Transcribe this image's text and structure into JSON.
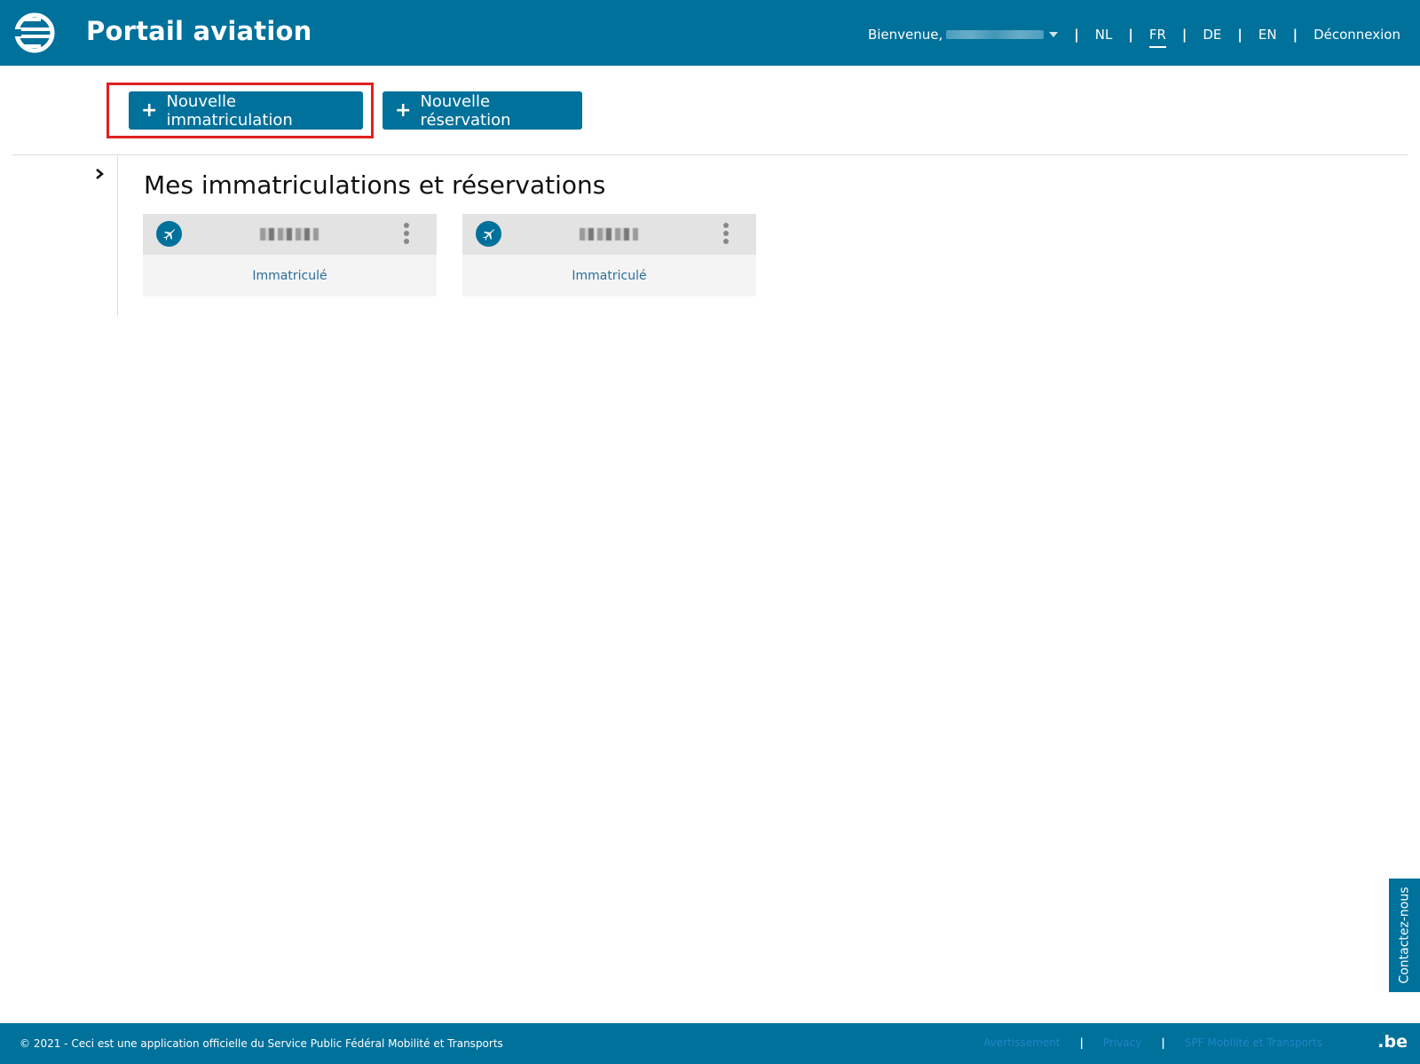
{
  "header": {
    "title": "Portail aviation",
    "welcome_label": "Bienvenue,",
    "languages": [
      "NL",
      "FR",
      "DE",
      "EN"
    ],
    "active_language": "FR",
    "logout_label": "Déconnexion",
    "brand_color": "#00719b"
  },
  "actions": {
    "new_registration_label": "Nouvelle immatriculation",
    "new_reservation_label": "Nouvelle réservation"
  },
  "main": {
    "section_title": "Mes immatriculations et réservations",
    "cards": [
      {
        "status": "Immatriculé"
      },
      {
        "status": "Immatriculé"
      }
    ]
  },
  "contact": {
    "label": "Contactez-nous"
  },
  "footer": {
    "copyright": "© 2021 - Ceci est une application officielle du Service Public Fédéral Mobilité et Transports",
    "links": [
      "Avertissement",
      "Privacy",
      "SPF Mobilité et Transports"
    ],
    "brand": ".be"
  }
}
